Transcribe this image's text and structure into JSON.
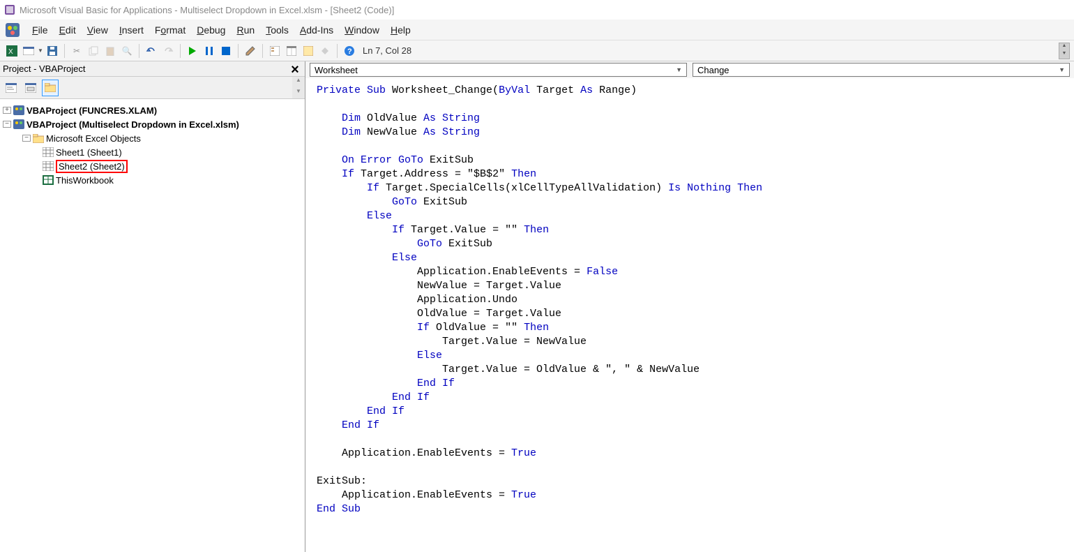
{
  "title": "Microsoft Visual Basic for Applications - Multiselect Dropdown in Excel.xlsm - [Sheet2 (Code)]",
  "menu": {
    "file": "File",
    "edit": "Edit",
    "view": "View",
    "insert": "Insert",
    "format": "Format",
    "debug": "Debug",
    "run": "Run",
    "tools": "Tools",
    "addins": "Add-Ins",
    "window": "Window",
    "help": "Help"
  },
  "cursor_status": "Ln 7, Col 28",
  "project_panel": {
    "title": "Project - VBAProject",
    "root1": "VBAProject (FUNCRES.XLAM)",
    "root2": "VBAProject (Multiselect Dropdown in Excel.xlsm)",
    "folder": "Microsoft Excel Objects",
    "sheet1": "Sheet1 (Sheet1)",
    "sheet2": "Sheet2 (Sheet2)",
    "thiswb": "ThisWorkbook"
  },
  "object_combo": "Worksheet",
  "proc_combo": "Change",
  "code_tokens": [
    [
      "kw",
      "Private Sub"
    ],
    [
      "tx",
      " Worksheet_Change("
    ],
    [
      "kw",
      "ByVal"
    ],
    [
      "tx",
      " Target "
    ],
    [
      "kw",
      "As"
    ],
    [
      "tx",
      " Range)"
    ],
    [
      "nl",
      ""
    ],
    [
      "nl",
      ""
    ],
    [
      "tx",
      "    "
    ],
    [
      "kw",
      "Dim"
    ],
    [
      "tx",
      " OldValue "
    ],
    [
      "kw",
      "As String"
    ],
    [
      "nl",
      ""
    ],
    [
      "tx",
      "    "
    ],
    [
      "kw",
      "Dim"
    ],
    [
      "tx",
      " NewValue "
    ],
    [
      "kw",
      "As String"
    ],
    [
      "nl",
      ""
    ],
    [
      "nl",
      ""
    ],
    [
      "tx",
      "    "
    ],
    [
      "kw",
      "On Error GoTo"
    ],
    [
      "tx",
      " ExitSub"
    ],
    [
      "nl",
      ""
    ],
    [
      "tx",
      "    "
    ],
    [
      "kw",
      "If"
    ],
    [
      "tx",
      " Target.Address = \"$B$2\" "
    ],
    [
      "kw",
      "Then"
    ],
    [
      "nl",
      ""
    ],
    [
      "tx",
      "        "
    ],
    [
      "kw",
      "If"
    ],
    [
      "tx",
      " Target.SpecialCells(xlCellTypeAllValidation) "
    ],
    [
      "kw",
      "Is Nothing Then"
    ],
    [
      "nl",
      ""
    ],
    [
      "tx",
      "            "
    ],
    [
      "kw",
      "GoTo"
    ],
    [
      "tx",
      " ExitSub"
    ],
    [
      "nl",
      ""
    ],
    [
      "tx",
      "        "
    ],
    [
      "kw",
      "Else"
    ],
    [
      "nl",
      ""
    ],
    [
      "tx",
      "            "
    ],
    [
      "kw",
      "If"
    ],
    [
      "tx",
      " Target.Value = \"\" "
    ],
    [
      "kw",
      "Then"
    ],
    [
      "nl",
      ""
    ],
    [
      "tx",
      "                "
    ],
    [
      "kw",
      "GoTo"
    ],
    [
      "tx",
      " ExitSub"
    ],
    [
      "nl",
      ""
    ],
    [
      "tx",
      "            "
    ],
    [
      "kw",
      "Else"
    ],
    [
      "nl",
      ""
    ],
    [
      "tx",
      "                Application.EnableEvents = "
    ],
    [
      "kw",
      "False"
    ],
    [
      "nl",
      ""
    ],
    [
      "tx",
      "                NewValue = Target.Value"
    ],
    [
      "nl",
      ""
    ],
    [
      "tx",
      "                Application.Undo"
    ],
    [
      "nl",
      ""
    ],
    [
      "tx",
      "                OldValue = Target.Value"
    ],
    [
      "nl",
      ""
    ],
    [
      "tx",
      "                "
    ],
    [
      "kw",
      "If"
    ],
    [
      "tx",
      " OldValue = \"\" "
    ],
    [
      "kw",
      "Then"
    ],
    [
      "nl",
      ""
    ],
    [
      "tx",
      "                    Target.Value = NewValue"
    ],
    [
      "nl",
      ""
    ],
    [
      "tx",
      "                "
    ],
    [
      "kw",
      "Else"
    ],
    [
      "nl",
      ""
    ],
    [
      "tx",
      "                    Target.Value = OldValue & \", \" & NewValue"
    ],
    [
      "nl",
      ""
    ],
    [
      "tx",
      "                "
    ],
    [
      "kw",
      "End If"
    ],
    [
      "nl",
      ""
    ],
    [
      "tx",
      "            "
    ],
    [
      "kw",
      "End If"
    ],
    [
      "nl",
      ""
    ],
    [
      "tx",
      "        "
    ],
    [
      "kw",
      "End If"
    ],
    [
      "nl",
      ""
    ],
    [
      "tx",
      "    "
    ],
    [
      "kw",
      "End If"
    ],
    [
      "nl",
      ""
    ],
    [
      "nl",
      ""
    ],
    [
      "tx",
      "    Application.EnableEvents = "
    ],
    [
      "kw",
      "True"
    ],
    [
      "nl",
      ""
    ],
    [
      "nl",
      ""
    ],
    [
      "tx",
      "ExitSub:"
    ],
    [
      "nl",
      ""
    ],
    [
      "tx",
      "    Application.EnableEvents = "
    ],
    [
      "kw",
      "True"
    ],
    [
      "nl",
      ""
    ],
    [
      "kw",
      "End Sub"
    ]
  ]
}
